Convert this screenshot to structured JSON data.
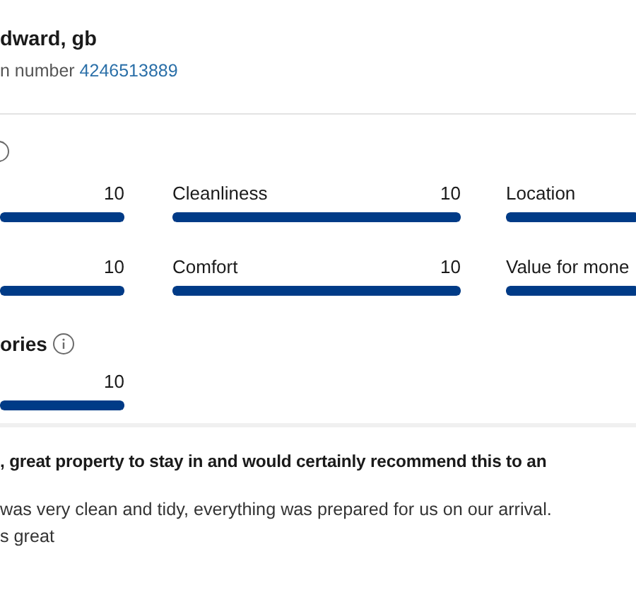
{
  "reviewer": {
    "name": "dward, gb",
    "booking_label": "n number",
    "booking_number": "4246513889"
  },
  "scores": {
    "categories": [
      {
        "score": "10",
        "level": 1
      },
      {
        "label": "Cleanliness",
        "score": "10",
        "level": 1
      },
      {
        "label": "Location",
        "level": 1
      },
      {
        "score": "10",
        "level": 1
      },
      {
        "label": "Comfort",
        "score": "10",
        "level": 1
      },
      {
        "label": "Value for mone",
        "level": 1
      }
    ]
  },
  "extra": {
    "title": "ories",
    "categories": [
      {
        "score": "10",
        "level": 1
      }
    ]
  },
  "review": {
    "title": ", great property to stay in and would certainly recommend this to an",
    "lines": [
      "was very clean and tidy, everything was prepared for us on our arrival.",
      "s great"
    ]
  }
}
